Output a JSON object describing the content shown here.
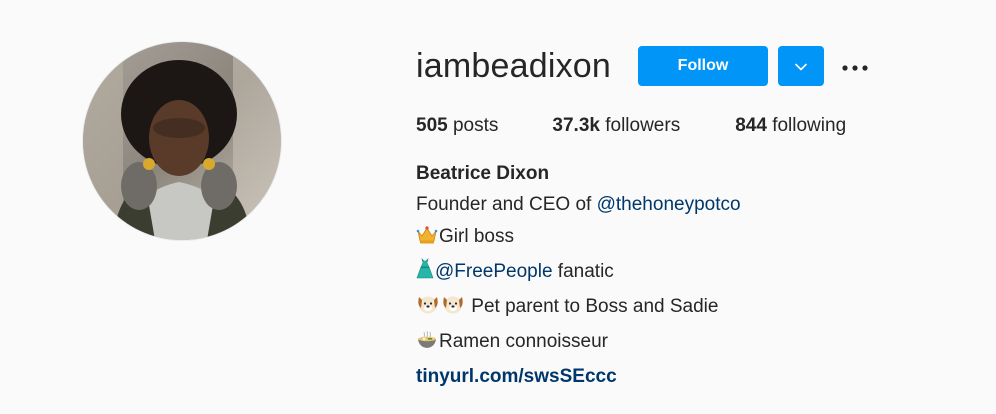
{
  "profile": {
    "username": "iambeadixon",
    "follow_label": "Follow",
    "stats": {
      "posts_count": "505",
      "posts_label": "posts",
      "followers_count": "37.3k",
      "followers_label": "followers",
      "following_count": "844",
      "following_label": "following"
    },
    "bio": {
      "name": "Beatrice Dixon",
      "line1_prefix": "Founder and CEO of ",
      "line1_mention": "@thehoneypotco",
      "line2": "Girl boss",
      "line3_mention": "@FreePeople",
      "line3_suffix": " fanatic",
      "line4": " Pet parent to Boss and Sadie",
      "line5": "Ramen connoisseur",
      "website": "tinyurl.com/swsSEccc"
    }
  },
  "icons": {
    "line2": "crown-emoji",
    "line3": "dress-emoji",
    "line4": "dog-face-emoji",
    "line5": "ramen-bowl-emoji",
    "dropdown": "chevron-down-icon",
    "more": "more-options-icon"
  },
  "colors": {
    "accent": "#0095f6",
    "link": "#00376b",
    "text": "#262626",
    "background": "#fafafa"
  }
}
